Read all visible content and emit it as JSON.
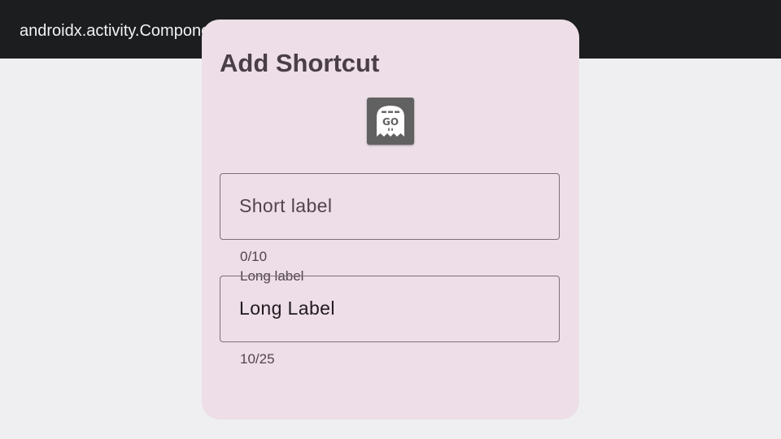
{
  "app_bar": {
    "title": "androidx.activity.ComponentActivity"
  },
  "dialog": {
    "title": "Add Shortcut",
    "icon": {
      "name": "ghost-go-icon",
      "glyph_text": "GO",
      "background": "#616161"
    },
    "short_label_field": {
      "placeholder": "Short label",
      "value": "",
      "counter": "0/10"
    },
    "long_label_field": {
      "label": "Long label",
      "value": "Long Label",
      "counter": "10/25"
    }
  },
  "colors": {
    "app_bar": "#1b1d1f",
    "background": "#efeff1",
    "dialog_surface": "#eddee7",
    "outline": "#7d7179",
    "on_surface_variant": "#51454d"
  }
}
